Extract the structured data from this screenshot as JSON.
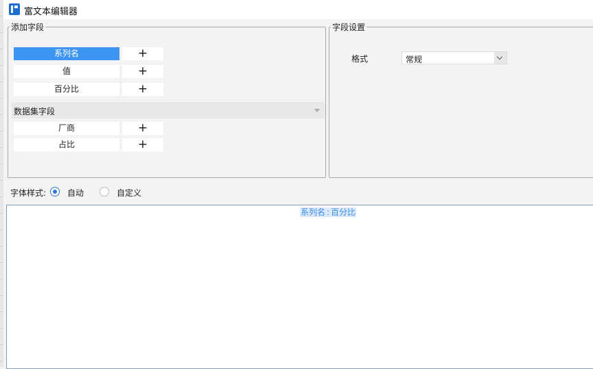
{
  "window": {
    "title": "富文本编辑器"
  },
  "add_fields": {
    "legend": "添加字段",
    "fields": [
      {
        "label": "系列名",
        "selected": true
      },
      {
        "label": "值",
        "selected": false
      },
      {
        "label": "百分比",
        "selected": false
      }
    ],
    "dataset": {
      "header": "数据集字段",
      "fields": [
        {
          "label": "厂商"
        },
        {
          "label": "占比"
        }
      ]
    },
    "add_symbol": "+"
  },
  "field_settings": {
    "legend": "字段设置",
    "format_label": "格式",
    "format_value": "常规"
  },
  "font_style": {
    "label": "字体样式:",
    "options": [
      {
        "label": "自动",
        "checked": true
      },
      {
        "label": "自定义",
        "checked": false
      }
    ]
  },
  "editor": {
    "token_left": "系列名",
    "separator": ":",
    "token_right": "百分比"
  },
  "colors": {
    "accent": "#3d95f1",
    "token_text": "#3d8ee6",
    "token_bg": "#dbe9fb"
  }
}
